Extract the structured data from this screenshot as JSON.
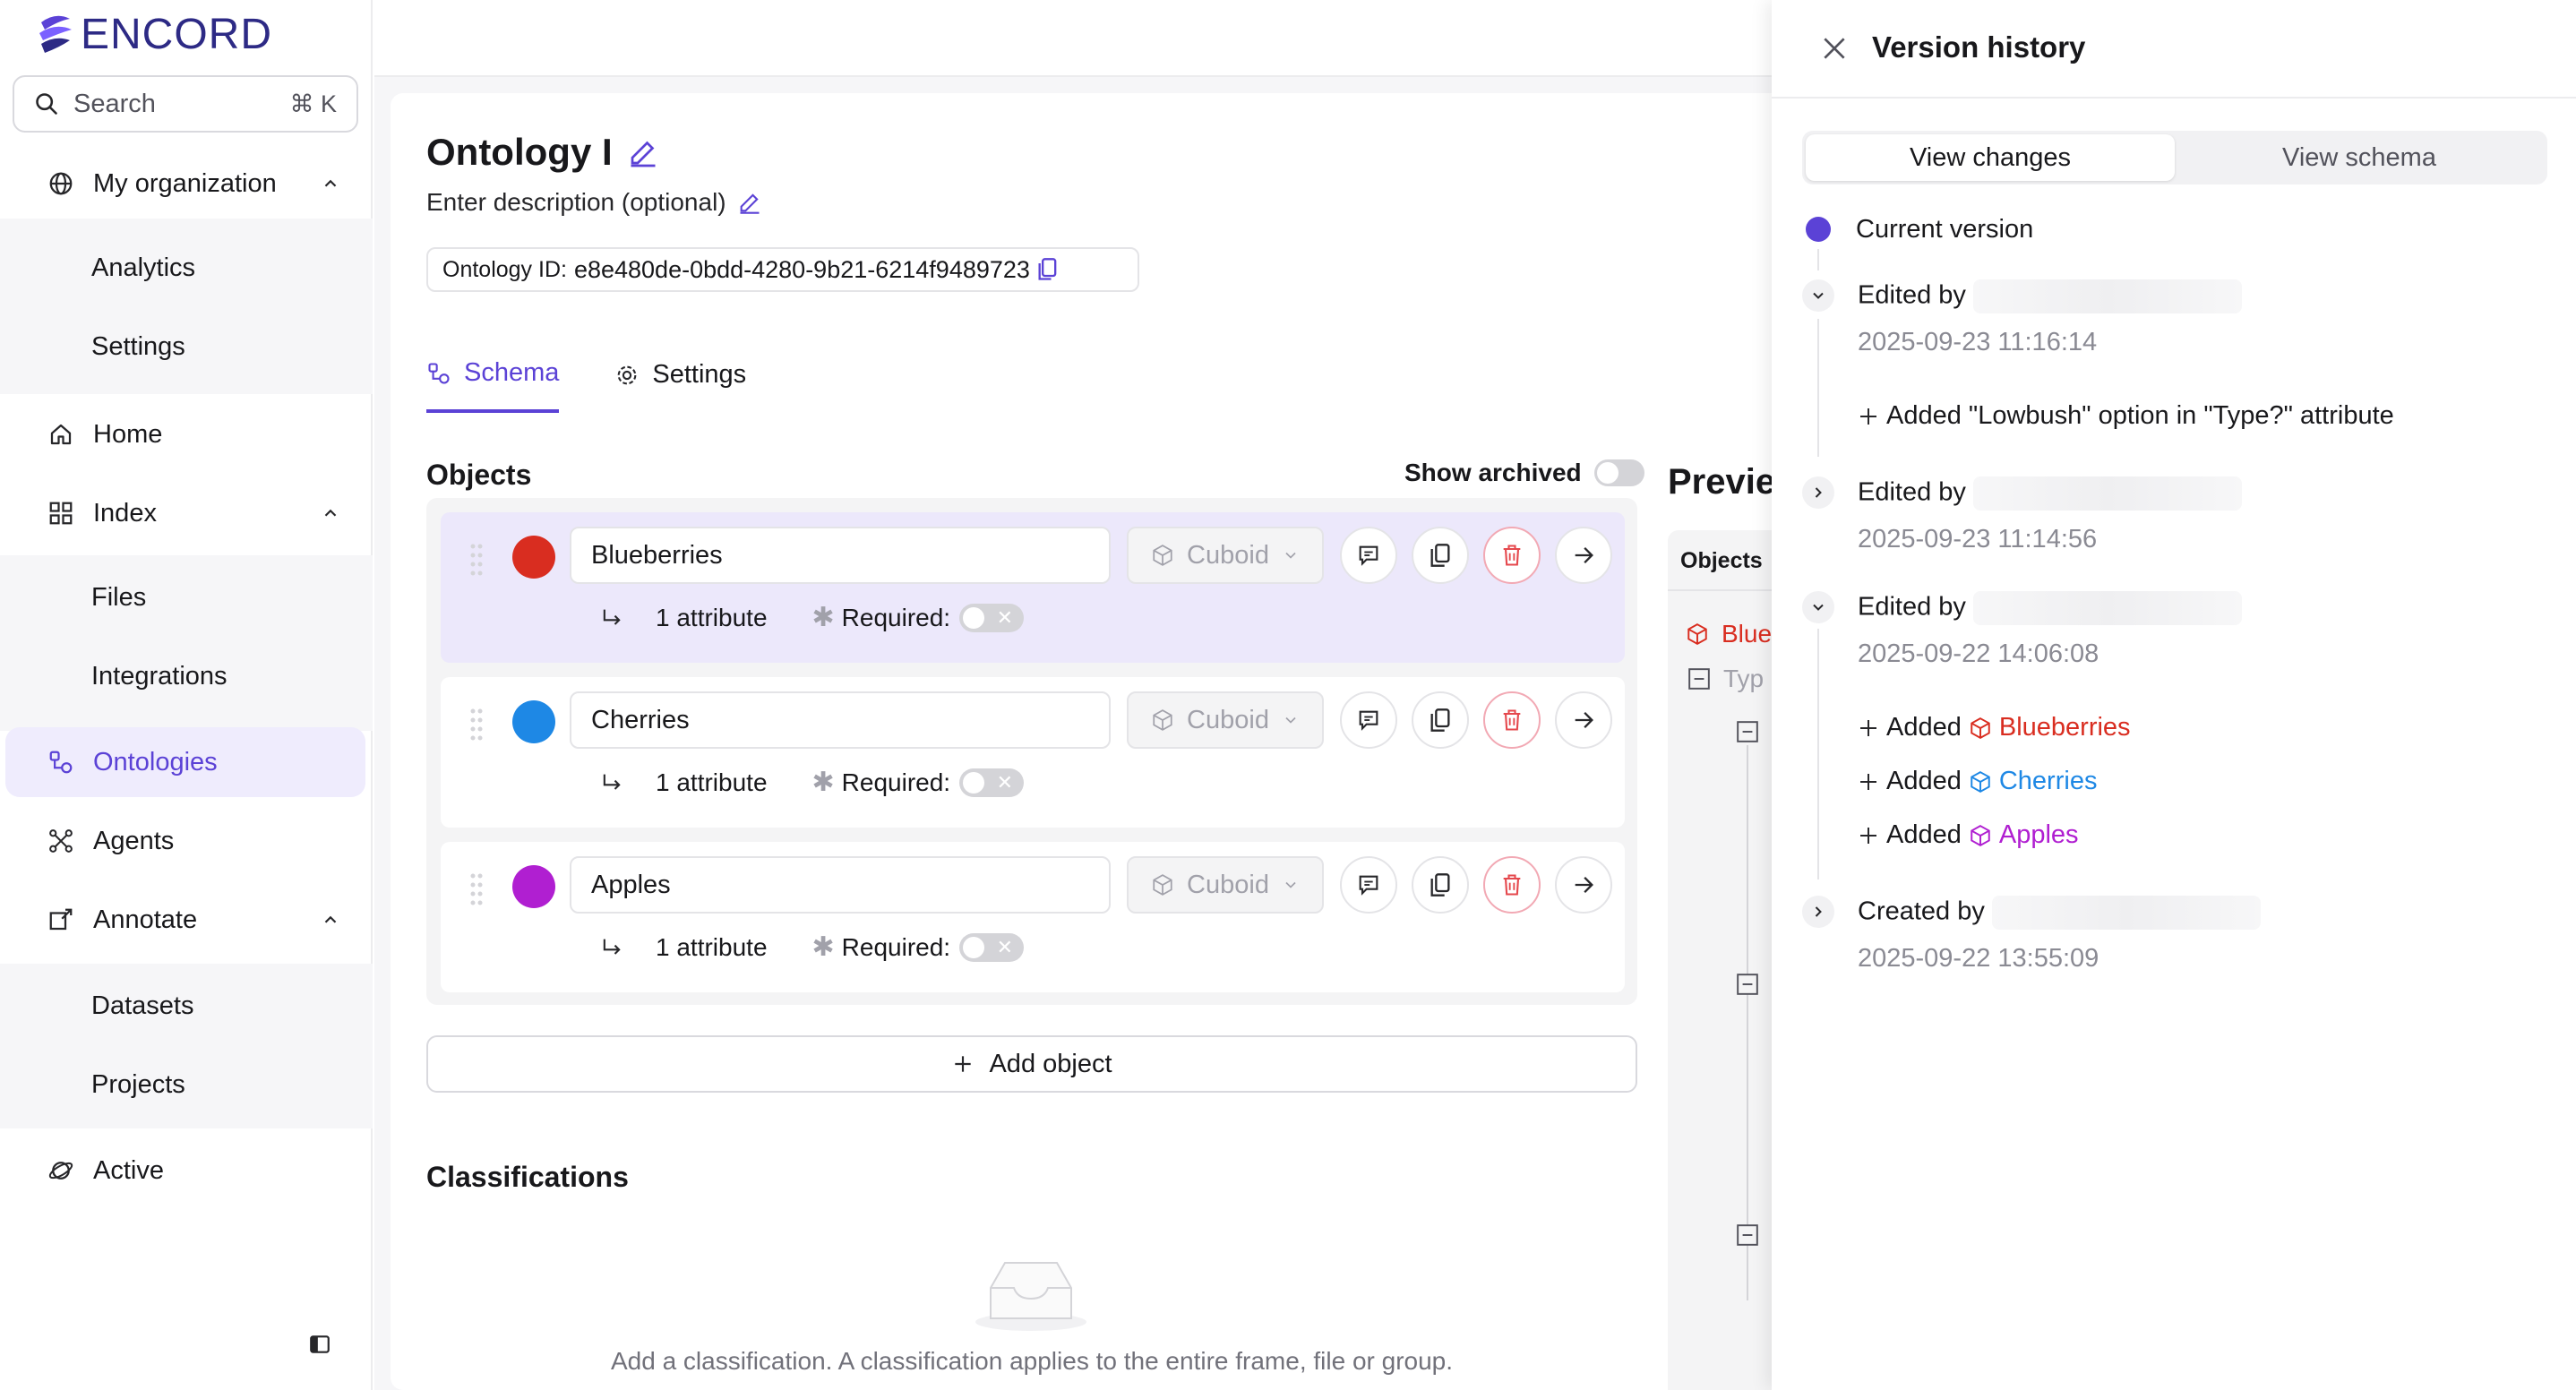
{
  "sidebar": {
    "brand": "ENCORD",
    "search": {
      "placeholder": "Search",
      "shortcut": "⌘ K"
    },
    "org": "My organization",
    "org_items": [
      "Analytics",
      "Settings"
    ],
    "home": "Home",
    "index": "Index",
    "index_items": [
      "Files",
      "Integrations"
    ],
    "ontologies": "Ontologies",
    "agents": "Agents",
    "annotate": "Annotate",
    "annotate_items": [
      "Datasets",
      "Projects"
    ],
    "active": "Active"
  },
  "main": {
    "title": "Ontology I",
    "description": "Enter description (optional)",
    "ontology_id_label": "Ontology ID:",
    "ontology_id": "e8e480de-0bdd-4280-9b21-6214f9489723",
    "tabs": [
      "Schema",
      "Settings"
    ],
    "objects_title": "Objects",
    "show_archived": "Show archived",
    "objects": [
      {
        "name": "Blueberries",
        "color": "#d92d20",
        "shape": "Cuboid",
        "attributes": "1 attribute",
        "required": "Required:"
      },
      {
        "name": "Cherries",
        "color": "#1e88e5",
        "shape": "Cuboid",
        "attributes": "1 attribute",
        "required": "Required:"
      },
      {
        "name": "Apples",
        "color": "#b01fd1",
        "shape": "Cuboid",
        "attributes": "1 attribute",
        "required": "Required:"
      }
    ],
    "add_object": "Add object",
    "classifications_title": "Classifications",
    "classifications_empty": "Add a classification. A classification applies to the entire frame, file or group."
  },
  "preview": {
    "title": "Previe",
    "objects_label": "Objects",
    "first_item": "Blue",
    "second_item": "Typ"
  },
  "version_history": {
    "title": "Version history",
    "tabs": [
      "View changes",
      "View schema"
    ],
    "current": "Current version",
    "accent": "#5b42d6",
    "entries": [
      {
        "action": "Edited by",
        "date": "2025-09-23 11:16:14",
        "change": "Added \"Lowbush\" option in \"Type?\" attribute"
      },
      {
        "action": "Edited by",
        "date": "2025-09-23 11:14:56"
      },
      {
        "action": "Edited by",
        "date": "2025-09-22 14:06:08",
        "added_prefix": "Added",
        "added": [
          {
            "name": "Blueberries",
            "color": "#d92d20"
          },
          {
            "name": "Cherries",
            "color": "#1e88e5"
          },
          {
            "name": "Apples",
            "color": "#b01fd1"
          }
        ]
      },
      {
        "action": "Created by",
        "date": "2025-09-22 13:55:09"
      }
    ]
  }
}
